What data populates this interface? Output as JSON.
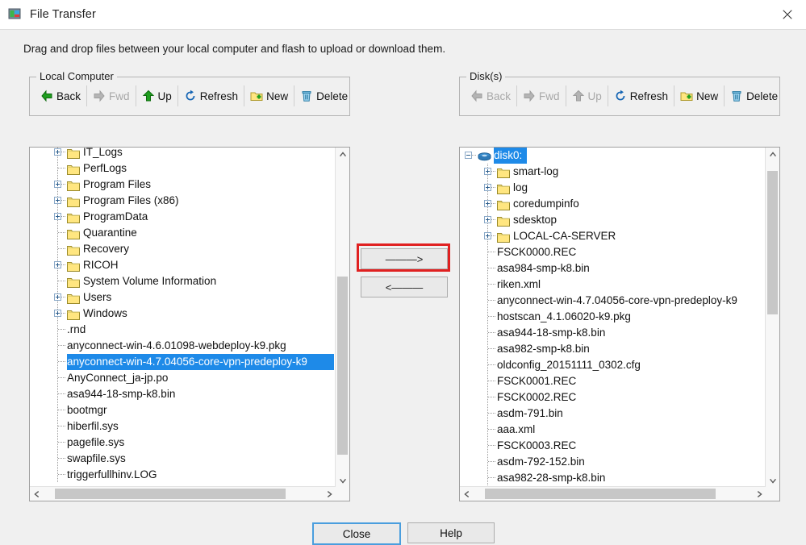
{
  "window": {
    "title": "File Transfer",
    "app_icon": "file-transfer-icon",
    "close_icon": "close-icon"
  },
  "instruction": "Drag and drop files between your local computer and flash to upload or download them.",
  "local": {
    "group_title": "Local Computer",
    "toolbar": [
      {
        "label": "Back",
        "icon": "arrow-left-icon",
        "enabled": true
      },
      {
        "label": "Fwd",
        "icon": "arrow-right-icon",
        "enabled": false
      },
      {
        "label": "Up",
        "icon": "arrow-up-icon",
        "enabled": true
      },
      {
        "label": "Refresh",
        "icon": "refresh-icon",
        "enabled": true
      },
      {
        "label": "New",
        "icon": "new-folder-icon",
        "enabled": true
      },
      {
        "label": "Delete",
        "icon": "trash-icon",
        "enabled": true
      }
    ],
    "tree": [
      {
        "label": "IT_Logs",
        "type": "folder",
        "expander": "plus",
        "clipped_top": true
      },
      {
        "label": "PerfLogs",
        "type": "folder",
        "expander": "none"
      },
      {
        "label": "Program Files",
        "type": "folder",
        "expander": "plus"
      },
      {
        "label": "Program Files (x86)",
        "type": "folder",
        "expander": "plus"
      },
      {
        "label": "ProgramData",
        "type": "folder",
        "expander": "plus"
      },
      {
        "label": "Quarantine",
        "type": "folder",
        "expander": "none"
      },
      {
        "label": "Recovery",
        "type": "folder",
        "expander": "none"
      },
      {
        "label": "RICOH",
        "type": "folder",
        "expander": "plus"
      },
      {
        "label": "System Volume Information",
        "type": "folder",
        "expander": "none"
      },
      {
        "label": "Users",
        "type": "folder",
        "expander": "plus"
      },
      {
        "label": "Windows",
        "type": "folder",
        "expander": "plus"
      },
      {
        "label": ".rnd",
        "type": "file"
      },
      {
        "label": "anyconnect-win-4.6.01098-webdeploy-k9.pkg",
        "type": "file"
      },
      {
        "label": "anyconnect-win-4.7.04056-core-vpn-predeploy-k9",
        "type": "file",
        "selected": true
      },
      {
        "label": "AnyConnect_ja-jp.po",
        "type": "file"
      },
      {
        "label": "asa944-18-smp-k8.bin",
        "type": "file"
      },
      {
        "label": "bootmgr",
        "type": "file"
      },
      {
        "label": "hiberfil.sys",
        "type": "file"
      },
      {
        "label": "pagefile.sys",
        "type": "file"
      },
      {
        "label": "swapfile.sys",
        "type": "file"
      },
      {
        "label": "triggerfullhinv.LOG",
        "type": "file"
      }
    ],
    "vscroll": {
      "up_icon": "chevron-up-icon",
      "down_icon": "chevron-down-icon",
      "thumb_top_pct": 37,
      "thumb_height_pct": 57
    },
    "hscroll": {
      "left_icon": "chevron-left-icon",
      "right_icon": "chevron-right-icon",
      "thumb_left_pct": 4,
      "thumb_width_pct": 83
    }
  },
  "disk": {
    "group_title": "Disk(s)",
    "toolbar": [
      {
        "label": "Back",
        "icon": "arrow-left-icon",
        "enabled": false
      },
      {
        "label": "Fwd",
        "icon": "arrow-right-icon",
        "enabled": false
      },
      {
        "label": "Up",
        "icon": "arrow-up-icon",
        "enabled": false
      },
      {
        "label": "Refresh",
        "icon": "refresh-icon",
        "enabled": true
      },
      {
        "label": "New",
        "icon": "new-folder-icon",
        "enabled": true
      },
      {
        "label": "Delete",
        "icon": "trash-icon",
        "enabled": true
      }
    ],
    "tree": [
      {
        "label": "disk0:",
        "type": "disk",
        "expander": "minus",
        "selected": true
      },
      {
        "label": "smart-log",
        "type": "folder",
        "expander": "plus"
      },
      {
        "label": "log",
        "type": "folder",
        "expander": "plus"
      },
      {
        "label": "coredumpinfo",
        "type": "folder",
        "expander": "plus"
      },
      {
        "label": "sdesktop",
        "type": "folder",
        "expander": "plus"
      },
      {
        "label": "LOCAL-CA-SERVER",
        "type": "folder",
        "expander": "plus"
      },
      {
        "label": "FSCK0000.REC",
        "type": "file"
      },
      {
        "label": "asa984-smp-k8.bin",
        "type": "file"
      },
      {
        "label": "riken.xml",
        "type": "file"
      },
      {
        "label": "anyconnect-win-4.7.04056-core-vpn-predeploy-k9",
        "type": "file"
      },
      {
        "label": "hostscan_4.1.06020-k9.pkg",
        "type": "file"
      },
      {
        "label": "asa944-18-smp-k8.bin",
        "type": "file"
      },
      {
        "label": "asa982-smp-k8.bin",
        "type": "file"
      },
      {
        "label": "oldconfig_20151111_0302.cfg",
        "type": "file"
      },
      {
        "label": "FSCK0001.REC",
        "type": "file"
      },
      {
        "label": "FSCK0002.REC",
        "type": "file"
      },
      {
        "label": "asdm-791.bin",
        "type": "file"
      },
      {
        "label": "aaa.xml",
        "type": "file"
      },
      {
        "label": "FSCK0003.REC",
        "type": "file"
      },
      {
        "label": "asdm-792-152.bin",
        "type": "file"
      },
      {
        "label": "asa982-28-smp-k8.bin",
        "type": "file",
        "clipped_bottom": true
      }
    ],
    "vscroll": {
      "up_icon": "chevron-up-icon",
      "down_icon": "chevron-down-icon",
      "thumb_top_pct": 3,
      "thumb_height_pct": 46
    },
    "hscroll": {
      "left_icon": "chevron-left-icon",
      "right_icon": "chevron-right-icon",
      "thumb_left_pct": 4,
      "thumb_width_pct": 83
    }
  },
  "transfer": {
    "to_disk_label": "———>",
    "to_local_label": "<———",
    "annotation_color": "#e02020"
  },
  "footer": {
    "close_label": "Close",
    "help_label": "Help"
  },
  "colors": {
    "selection": "#1e8ae8",
    "folder": "#ffe680",
    "accent_green": "#22a022",
    "accent_blue": "#1464b4",
    "annotation": "#e02020",
    "focus_border": "#4a9ede"
  }
}
